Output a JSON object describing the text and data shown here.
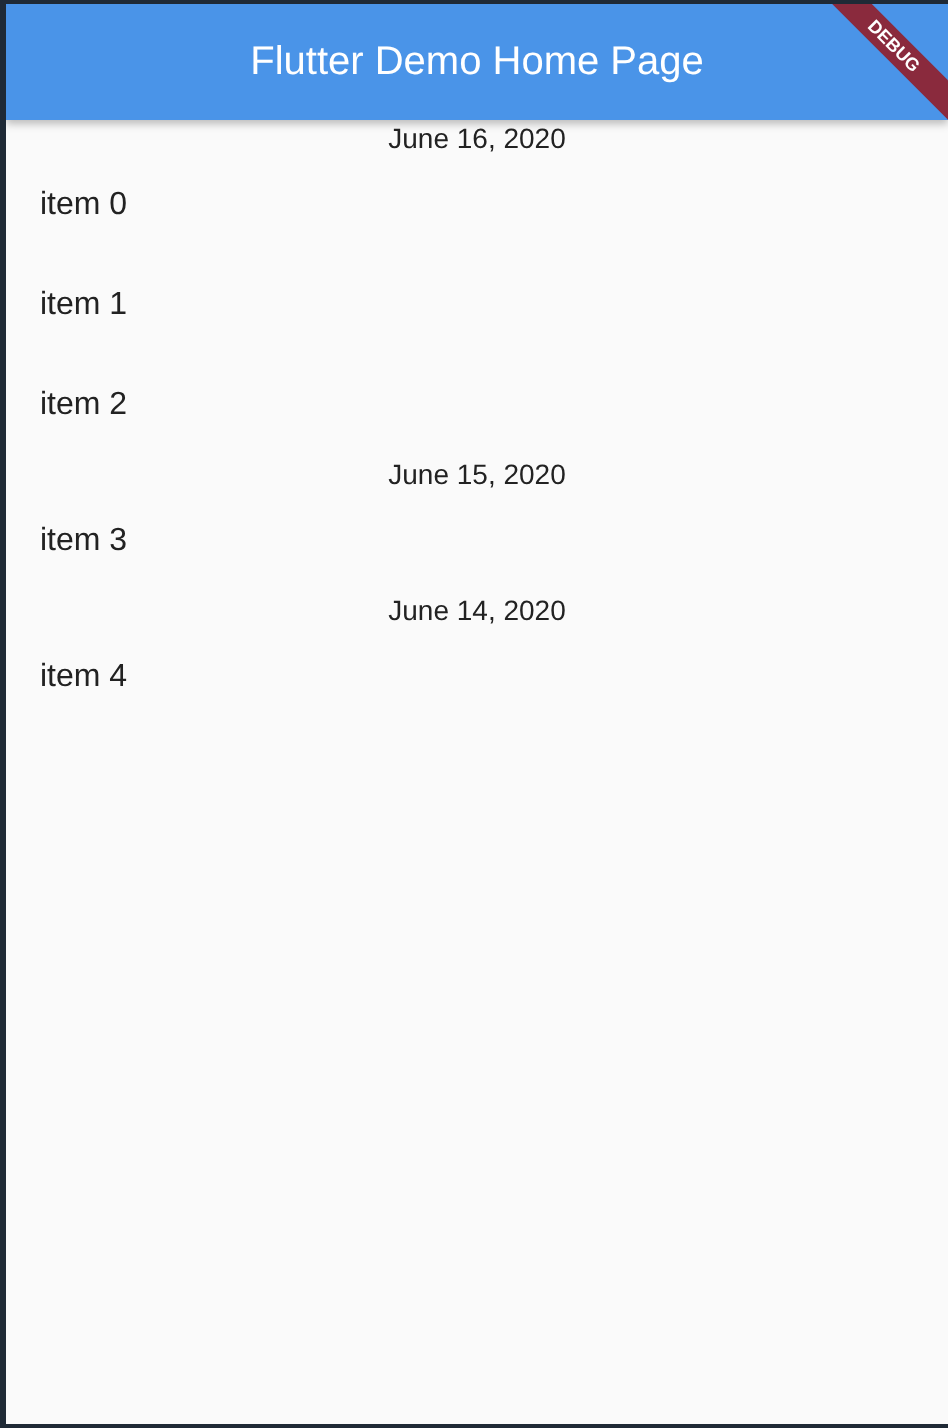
{
  "app_bar": {
    "title": "Flutter Demo Home Page"
  },
  "debug_banner": {
    "label": "DEBUG"
  },
  "entries": [
    {
      "kind": "date",
      "text": "June 16, 2020"
    },
    {
      "kind": "item",
      "text": "item 0"
    },
    {
      "kind": "item",
      "text": "item 1"
    },
    {
      "kind": "item",
      "text": "item 2"
    },
    {
      "kind": "date",
      "text": "June 15, 2020"
    },
    {
      "kind": "item",
      "text": "item 3"
    },
    {
      "kind": "date",
      "text": "June 14, 2020"
    },
    {
      "kind": "item",
      "text": "item 4"
    }
  ]
}
